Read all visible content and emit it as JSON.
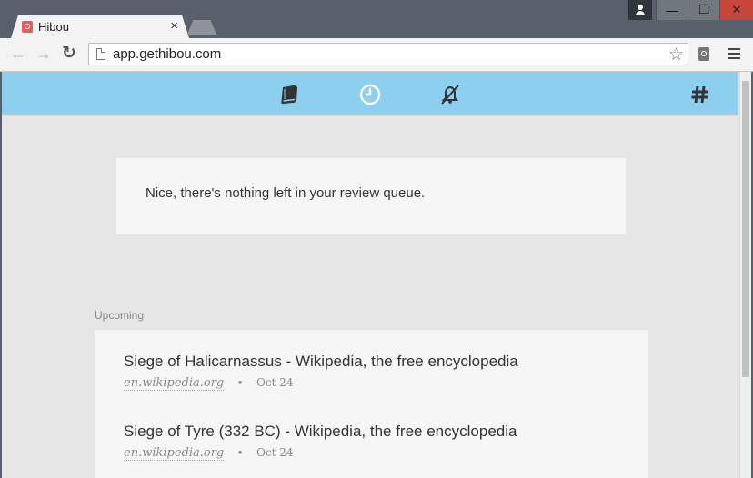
{
  "browser": {
    "tab": {
      "title": "Hibou",
      "close_glyph": "×"
    },
    "window_controls": {
      "minimize": "—",
      "maximize": "❐",
      "close": "✕"
    },
    "toolbar": {
      "back_glyph": "←",
      "forward_glyph": "→",
      "reload_glyph": "↻",
      "url": "app.gethibou.com",
      "star_glyph": "☆"
    }
  },
  "app": {
    "header": {
      "icons": [
        "book-icon",
        "clock-icon",
        "bell-off-icon",
        "hash-icon"
      ],
      "accent": "#8ccfef"
    },
    "review": {
      "message": "Nice, there's nothing left in your review queue."
    },
    "upcoming": {
      "label": "Upcoming",
      "items": [
        {
          "title": "Siege of Halicarnassus - Wikipedia, the free encyclopedia",
          "domain": "en.wikipedia.org",
          "separator": "•",
          "date": "Oct 24"
        },
        {
          "title": "Siege of Tyre (332 BC) - Wikipedia, the free encyclopedia",
          "domain": "en.wikipedia.org",
          "separator": "•",
          "date": "Oct 24"
        }
      ]
    }
  }
}
